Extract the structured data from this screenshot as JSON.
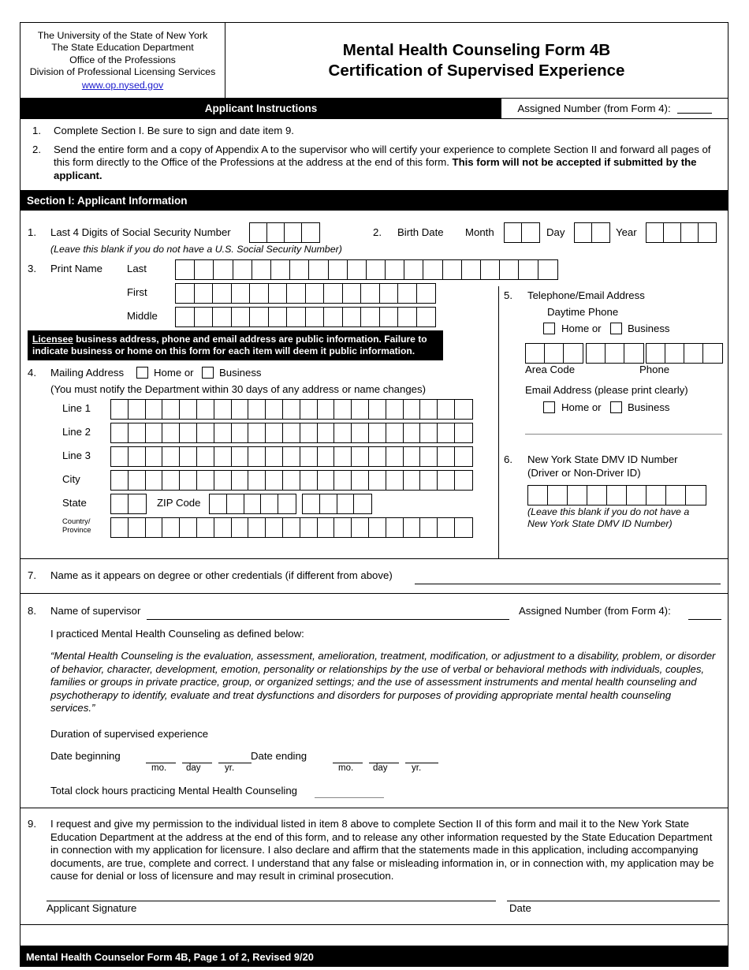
{
  "header": {
    "agency_lines": [
      "The University of the State of New York",
      "The State Education Department",
      "Office of the Professions",
      "Division of Professional Licensing Services"
    ],
    "website": "www.op.nysed.gov",
    "title_line1": "Mental Health Counseling Form 4B",
    "title_line2": "Certification of Supervised Experience"
  },
  "bars": {
    "applicant_instructions": "Applicant Instructions",
    "assigned_number_label": "Assigned Number (from Form 4):",
    "section1_title": "Section I: Applicant Information"
  },
  "instructions": [
    {
      "num": "1.",
      "text": "Complete Section I. Be sure to sign and date item 9."
    },
    {
      "num": "2.",
      "text_a": "Send the entire form and a copy of Appendix A to the supervisor who will certify your experience to complete Section II and forward all pages of this form directly to the Office of the Professions at the address at the end of this form. ",
      "text_bold": "This form will not be accepted if submitted by the applicant."
    }
  ],
  "section1": {
    "item1": {
      "num": "1.",
      "label": "Last 4 Digits of Social Security Number",
      "note": "(Leave this blank if you do not have a U.S. Social Security Number)",
      "boxes": 4
    },
    "item2": {
      "num": "2.",
      "label": "Birth Date",
      "month_label": "Month",
      "day_label": "Day",
      "year_label": "Year",
      "month_boxes": 2,
      "day_boxes": 2,
      "year_boxes": 4
    },
    "item3": {
      "num": "3.",
      "label": "Print Name",
      "rows": [
        {
          "label": "Last",
          "boxes": 20
        },
        {
          "label": "First",
          "boxes": 14
        },
        {
          "label": "Middle",
          "boxes": 14
        }
      ]
    },
    "licensee_notice": {
      "underlined_word": "Licensee",
      "rest": " business address, phone and email address are public information. Failure to indicate business or home on this form for each item will deem it public information."
    },
    "item4": {
      "num": "4.",
      "label": "Mailing Address",
      "home_label": "Home or",
      "business_label": "Business",
      "note": "(You must notify the Department within 30 days of any address or name changes)",
      "rows": [
        {
          "label": "Line 1",
          "boxes": 21
        },
        {
          "label": "Line 2",
          "boxes": 21
        },
        {
          "label": "Line 3",
          "boxes": 21
        },
        {
          "label": "City",
          "boxes": 21
        }
      ],
      "state_label": "State",
      "state_boxes": 2,
      "zip_label": "ZIP Code",
      "zip_boxes_1": 5,
      "zip_boxes_2": 4,
      "country_label_1": "Country/",
      "country_label_2": "Province",
      "country_boxes": 21
    },
    "item5": {
      "num": "5.",
      "label": "Telephone/Email Address",
      "daytime_label": "Daytime Phone",
      "home_label": "Home or",
      "business_label": "Business",
      "area_boxes": 3,
      "prefix_boxes": 3,
      "line_boxes": 4,
      "area_code_label": "Area Code",
      "phone_label": "Phone",
      "email_label": "Email Address (please print clearly)",
      "email_home_label": "Home or",
      "email_business_label": "Business"
    },
    "item6": {
      "num": "6.",
      "label_line1": "New York State DMV ID Number",
      "label_line2": "(Driver or Non-Driver ID)",
      "boxes": 9,
      "note_line1": "(Leave this blank if you do not have a",
      "note_line2": "New York State DMV ID Number)"
    }
  },
  "item7": {
    "num": "7.",
    "label": "Name as it appears on degree or other credentials (if different from above)"
  },
  "item8": {
    "num": "8.",
    "label": "Name of supervisor",
    "assigned_number_label": "Assigned Number (from Form 4):",
    "practiced_line": "I practiced Mental Health Counseling as defined below:",
    "definition": "“Mental Health Counseling is the evaluation, assessment, amelioration, treatment, modification, or adjustment to a disability, problem, or disorder of behavior, character, development, emotion, personality or relationships by the use of verbal or behavioral methods with individuals, couples, families or groups in private practice, group, or organized settings; and the use of assessment instruments and mental health counseling and psychotherapy to identify, evaluate and treat dysfunctions and disorders for purposes of providing appropriate mental health counseling services.”",
    "duration_label": "Duration of supervised experience",
    "date_begin_label": "Date beginning",
    "date_end_label": "Date ending",
    "mo_label": "mo.",
    "day_label": "day",
    "yr_label": "yr.",
    "total_hours_label": "Total clock hours practicing Mental Health Counseling"
  },
  "item9": {
    "num": "9.",
    "text": "I request and give my permission to the individual listed in item 8 above to complete Section II of this form and mail it to the New York State Education Department at the address at the end of this form, and to release any other information requested by the State Education Department in connection with my application for licensure. I also declare and affirm that the statements made in this application, including accompanying documents, are true, complete and correct. I understand that any false or misleading information in, or in connection with, my application may be cause for denial or loss of licensure and may result in criminal prosecution.",
    "signature_label": "Applicant Signature",
    "date_label": "Date"
  },
  "footer": {
    "text": "Mental Health Counselor Form 4B, Page 1 of 2, Revised 9/20"
  },
  "colors": {
    "bar_background": "#000000",
    "bar_text": "#ffffff",
    "link": "#1a1acc"
  }
}
